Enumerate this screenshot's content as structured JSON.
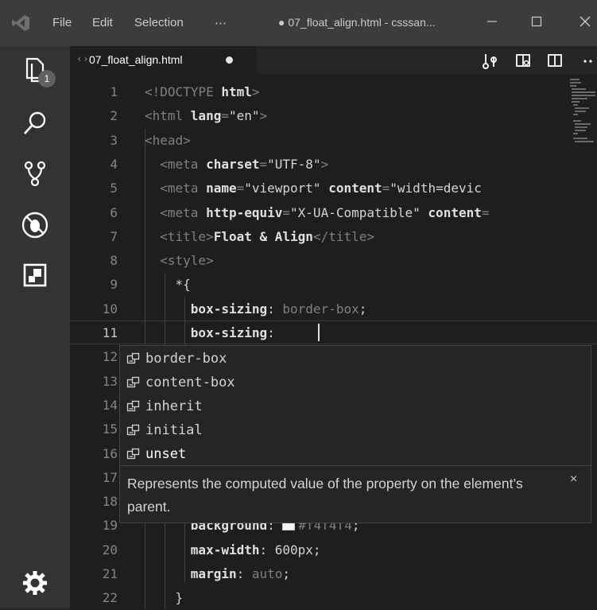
{
  "titlebar": {
    "menu": [
      "File",
      "Edit",
      "Selection",
      "⋯"
    ],
    "title": "● 07_float_align.html - csssan...",
    "controls": [
      "minimize-icon",
      "maximize-icon",
      "close-icon"
    ]
  },
  "activity": {
    "icons": [
      "explorer-icon",
      "search-icon",
      "source-control-icon",
      "debug-icon",
      "extensions-icon",
      "settings-gear-icon"
    ],
    "explorer_badge": "1"
  },
  "tab": {
    "lead": "‹›",
    "label": "07_float_align.html",
    "modified": true,
    "actions": [
      "open-changes-icon",
      "preview-icon",
      "split-editor-icon",
      "more-actions-icon"
    ]
  },
  "editor": {
    "current_line": 11,
    "lines": [
      {
        "n": "1",
        "tokens": [
          [
            "tok-punct",
            "<!DOCTYPE "
          ],
          [
            "tok-bold",
            "html"
          ],
          [
            "tok-punct",
            ">"
          ]
        ]
      },
      {
        "n": "2",
        "tokens": [
          [
            "tok-punct",
            "<html "
          ],
          [
            "tok-bold",
            "lang"
          ],
          [
            "tok-punct",
            "="
          ],
          [
            "tok-plain",
            "\"en\""
          ],
          [
            "tok-punct",
            ">"
          ]
        ]
      },
      {
        "n": "3",
        "tokens": [
          [
            "tok-punct",
            "<head>"
          ]
        ]
      },
      {
        "n": "4",
        "tokens": [
          [
            "tok-punct",
            "  <meta "
          ],
          [
            "tok-bold",
            "charset"
          ],
          [
            "tok-punct",
            "="
          ],
          [
            "tok-plain",
            "\"UTF-8\""
          ],
          [
            "tok-punct",
            ">"
          ]
        ]
      },
      {
        "n": "5",
        "tokens": [
          [
            "tok-punct",
            "  <meta "
          ],
          [
            "tok-bold",
            "name"
          ],
          [
            "tok-punct",
            "="
          ],
          [
            "tok-plain",
            "\"viewport\" "
          ],
          [
            "tok-bold",
            "content"
          ],
          [
            "tok-punct",
            "="
          ],
          [
            "tok-plain",
            "\"width=devic"
          ]
        ]
      },
      {
        "n": "6",
        "tokens": [
          [
            "tok-punct",
            "  <meta "
          ],
          [
            "tok-bold",
            "http-equiv"
          ],
          [
            "tok-punct",
            "="
          ],
          [
            "tok-plain",
            "\"X-UA-Compatible\" "
          ],
          [
            "tok-bold",
            "content"
          ],
          [
            "tok-punct",
            "="
          ]
        ]
      },
      {
        "n": "7",
        "tokens": [
          [
            "tok-punct",
            "  <title>"
          ],
          [
            "tok-bold",
            "Float & Align"
          ],
          [
            "tok-punct",
            "</title>"
          ]
        ]
      },
      {
        "n": "8",
        "tokens": [
          [
            "tok-punct",
            "  <style>"
          ]
        ]
      },
      {
        "n": "9",
        "tokens": [
          [
            "tok-plain",
            "    *{"
          ]
        ]
      },
      {
        "n": "10",
        "tokens": [
          [
            "tok-plain",
            "      "
          ],
          [
            "tok-bold",
            "box-sizing"
          ],
          [
            "tok-plain",
            ": "
          ],
          [
            "tok-punct",
            "border-box"
          ],
          [
            "tok-plain",
            ";"
          ]
        ]
      },
      {
        "n": "11",
        "tokens": [
          [
            "tok-plain",
            "      "
          ],
          [
            "tok-bold",
            "box-sizing"
          ],
          [
            "tok-plain",
            ": "
          ]
        ]
      },
      {
        "n": "12",
        "tokens": []
      },
      {
        "n": "13",
        "tokens": []
      },
      {
        "n": "14",
        "tokens": []
      },
      {
        "n": "15",
        "tokens": []
      },
      {
        "n": "16",
        "tokens": []
      },
      {
        "n": "17",
        "tokens": []
      },
      {
        "n": "18",
        "tokens": []
      },
      {
        "n": "19",
        "tokens": [
          [
            "tok-plain",
            "      "
          ],
          [
            "tok-bold",
            "background"
          ],
          [
            "tok-plain",
            ": "
          ],
          [
            "tok-swatch",
            ""
          ],
          [
            "tok-punct",
            "#f4f4f4"
          ],
          [
            "tok-plain",
            ";"
          ]
        ]
      },
      {
        "n": "20",
        "tokens": [
          [
            "tok-plain",
            "      "
          ],
          [
            "tok-bold",
            "max-width"
          ],
          [
            "tok-plain",
            ": 600px;"
          ]
        ]
      },
      {
        "n": "21",
        "tokens": [
          [
            "tok-plain",
            "      "
          ],
          [
            "tok-bold",
            "margin"
          ],
          [
            "tok-plain",
            ": "
          ],
          [
            "tok-punct",
            "auto"
          ],
          [
            "tok-plain",
            ";"
          ]
        ]
      },
      {
        "n": "22",
        "tokens": [
          [
            "tok-plain",
            "    }"
          ]
        ]
      }
    ]
  },
  "suggest": {
    "items": [
      "border-box",
      "content-box",
      "inherit",
      "initial",
      "unset"
    ],
    "focused_index": 4,
    "doc": "Represents the computed value of the property on the element’s parent.",
    "close": "×"
  }
}
